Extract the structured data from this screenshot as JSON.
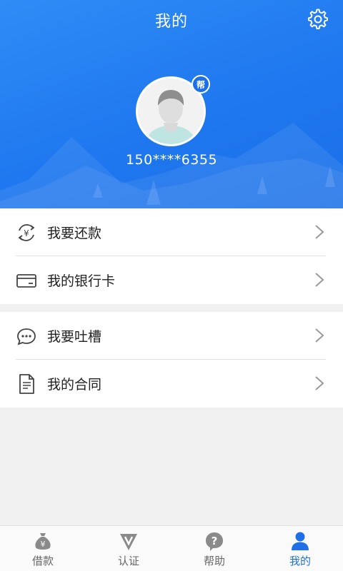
{
  "header": {
    "title": "我的",
    "settings_icon": "gear-icon",
    "avatar_badge": "帮",
    "phone": "150****6355",
    "bg_color": "#1f78ef"
  },
  "menu": {
    "group1": [
      {
        "icon": "yuan-cycle-icon",
        "label": "我要还款"
      },
      {
        "icon": "bank-card-icon",
        "label": "我的银行卡"
      }
    ],
    "group2": [
      {
        "icon": "chat-bubble-icon",
        "label": "我要吐槽"
      },
      {
        "icon": "document-icon",
        "label": "我的合同"
      }
    ]
  },
  "tabbar": {
    "active_color": "#1f6fe6",
    "items": [
      {
        "icon": "money-bag-icon",
        "label": "借款"
      },
      {
        "icon": "verify-v-icon",
        "label": "认证"
      },
      {
        "icon": "help-question-icon",
        "label": "帮助"
      },
      {
        "icon": "user-icon",
        "label": "我的",
        "active": true
      }
    ]
  }
}
